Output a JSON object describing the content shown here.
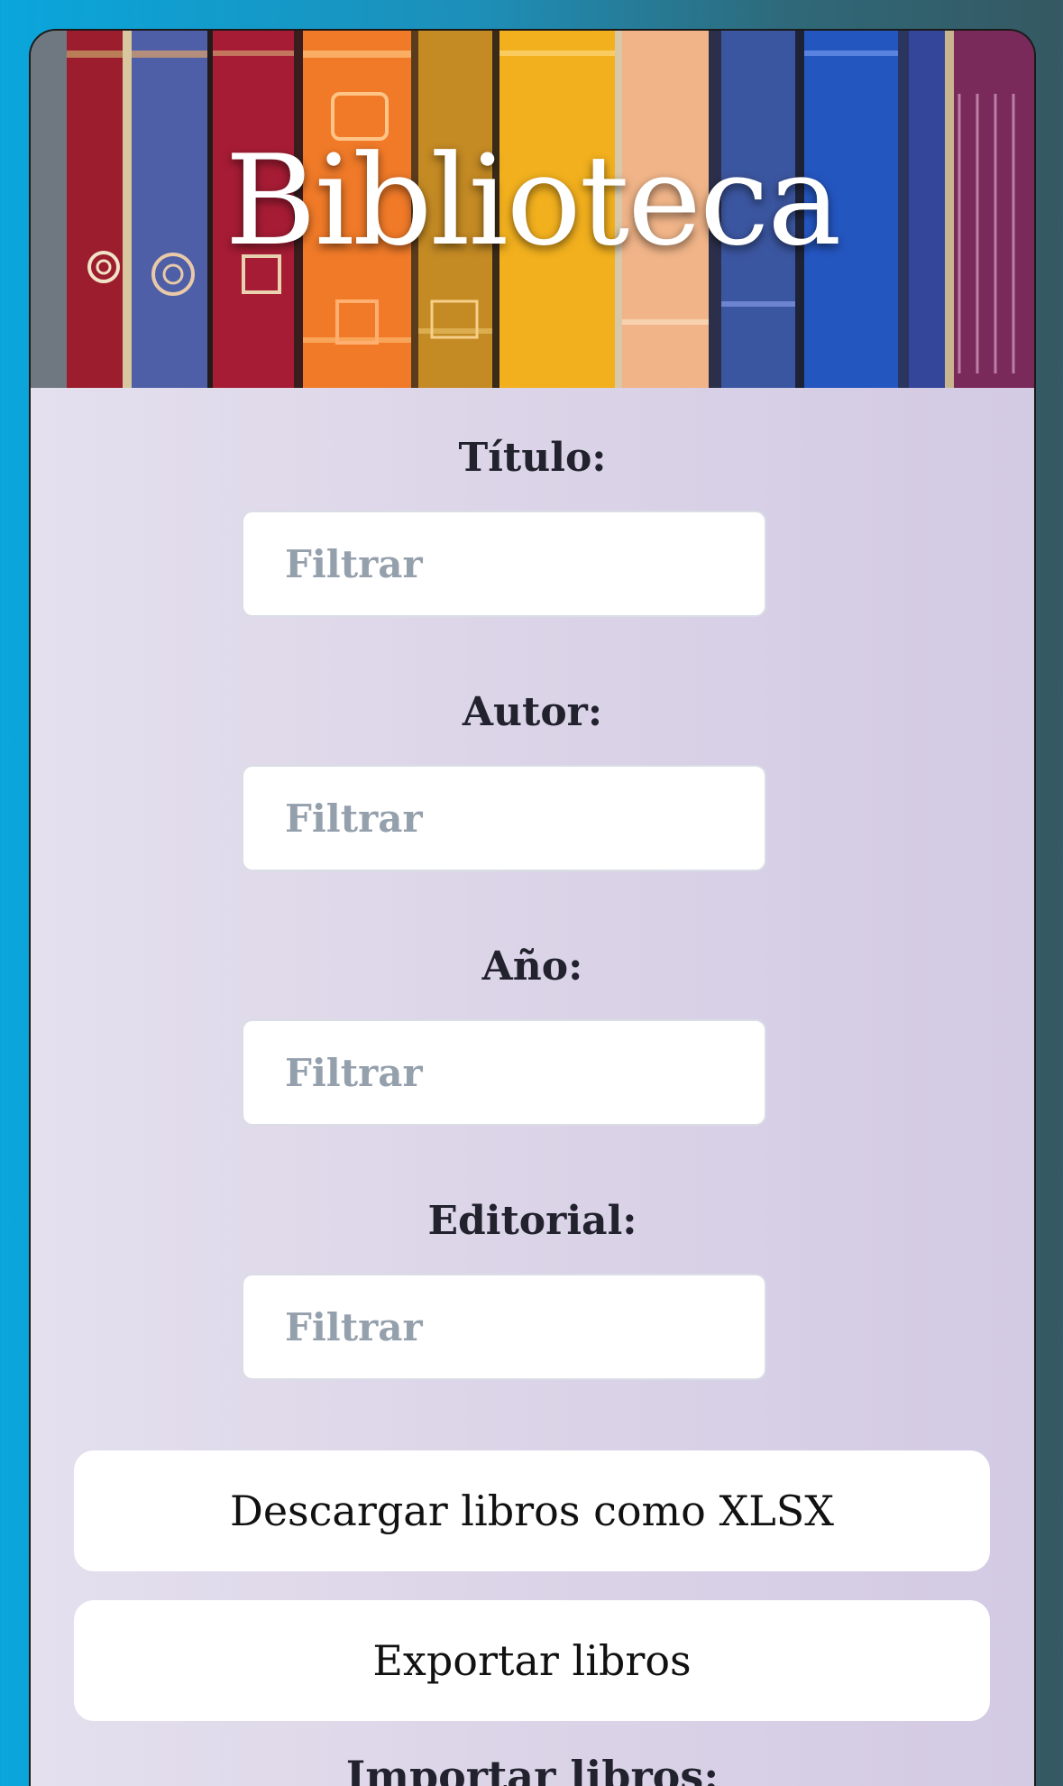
{
  "header": {
    "title": "Biblioteca"
  },
  "filters": [
    {
      "label": "Título:",
      "placeholder": "Filtrar",
      "value": ""
    },
    {
      "label": "Autor:",
      "placeholder": "Filtrar",
      "value": ""
    },
    {
      "label": "Año:",
      "placeholder": "Filtrar",
      "value": ""
    },
    {
      "label": "Editorial:",
      "placeholder": "Filtrar",
      "value": ""
    }
  ],
  "actions": {
    "download_xlsx_label": "Descargar libros como XLSX",
    "export_label": "Exportar libros",
    "import_label": "Importar libros:"
  },
  "colors": {
    "page_gradient_start": "#0aa6dc",
    "page_gradient_end": "#355862",
    "card_background": "#dcd5e8",
    "placeholder_text": "#95a0ad",
    "label_text": "#22222e"
  }
}
